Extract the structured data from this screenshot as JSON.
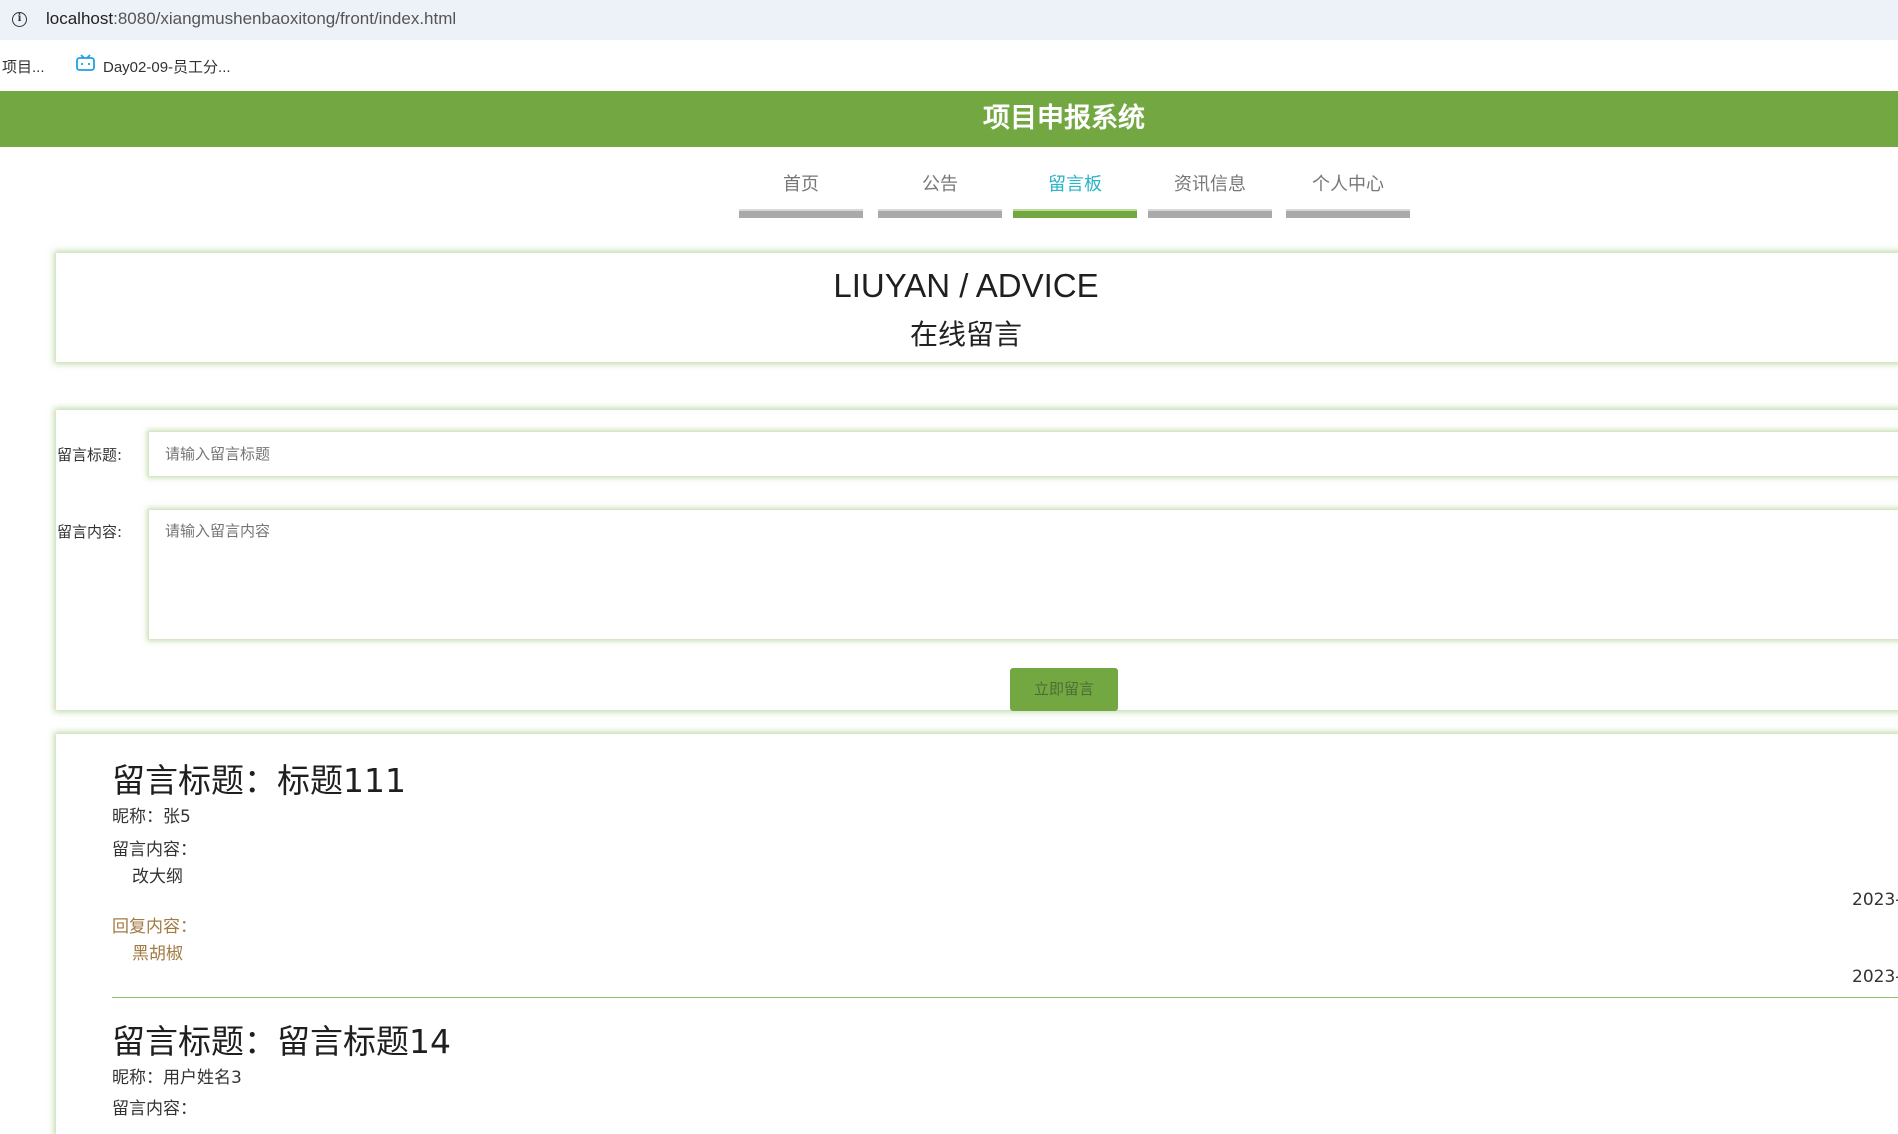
{
  "browser": {
    "url_host": "localhost",
    "url_path": ":8080/xiangmushenbaoxitong/front/index.html",
    "bookmarks": [
      {
        "label": "项目..."
      },
      {
        "label": "Day02-09-员工分..."
      }
    ],
    "colors": {
      "address_bar": "#edf1f8",
      "bookmark_icon": "#1fa1e0"
    }
  },
  "site": {
    "title": "项目申报系统",
    "header_color": "#73a742"
  },
  "nav": {
    "items": [
      {
        "label": "首页",
        "active": false
      },
      {
        "label": "公告",
        "active": false
      },
      {
        "label": "留言板",
        "active": true
      },
      {
        "label": "资讯信息",
        "active": false
      },
      {
        "label": "个人中心",
        "active": false
      }
    ],
    "active_color": "#2bb3c8"
  },
  "banner": {
    "title": "LIUYAN / ADVICE",
    "subtitle": "在线留言"
  },
  "form": {
    "title_label": "留言标题:",
    "title_placeholder": "请输入留言标题",
    "title_value": "",
    "content_label": "留言内容:",
    "content_placeholder": "请输入留言内容",
    "content_value": "",
    "submit_label": "立即留言"
  },
  "messages": [
    {
      "title": "留言标题：标题111",
      "nickname": "昵称：张5",
      "content_label": "留言内容：",
      "content": "改大纲",
      "date": "2023-",
      "reply_label": "回复内容：",
      "reply": "黑胡椒",
      "reply_date": "2023-"
    },
    {
      "title": "留言标题：留言标题14",
      "nickname": "昵称：用户姓名3",
      "content_label": "留言内容："
    }
  ]
}
